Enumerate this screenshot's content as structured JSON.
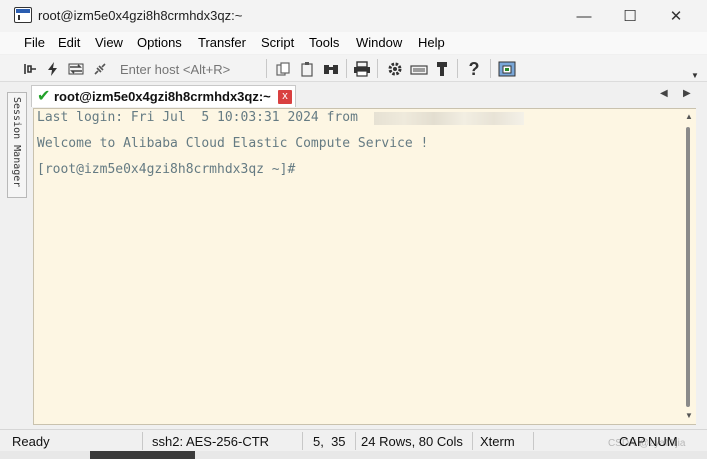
{
  "window": {
    "title": "root@izm5e0x4gzi8h8crmhdx3qz:~",
    "minimize_glyph": "—",
    "maximize_glyph": "☐",
    "close_glyph": "✕"
  },
  "menu": {
    "items": [
      "File",
      "Edit",
      "View",
      "Options",
      "Transfer",
      "Script",
      "Tools",
      "Window",
      "Help"
    ]
  },
  "toolbar": {
    "enter_host_placeholder": "Enter host <Alt+R>",
    "icons": [
      "connect-icon",
      "quick-connect-icon",
      "reconnect-icon",
      "disconnect-icon",
      "copy-icon",
      "paste-icon",
      "find-icon",
      "print-icon",
      "settings-icon",
      "keymap-icon",
      "sftp-icon",
      "help-icon",
      "screenshot-icon"
    ]
  },
  "sidebar": {
    "session_manager_label": "Session Manager"
  },
  "tab": {
    "label": "root@izm5e0x4gzi8h8crmhdx3qz:~",
    "close_glyph": "x",
    "check_glyph": "✔"
  },
  "terminal": {
    "lines": [
      "Last login: Fri Jul  5 10:03:31 2024 from ",
      "Welcome to Alibaba Cloud Elastic Compute Service !",
      "[root@izm5e0x4gzi8h8crmhdx3qz ~]#"
    ]
  },
  "statusbar": {
    "ready": "Ready",
    "cipher": "ssh2: AES-256-CTR",
    "cursor": "5,  35",
    "dimensions": "24 Rows, 80 Cols",
    "terminal_type": "Xterm",
    "caps": "CAP",
    "num": "NUM",
    "watermark": "CSDN @zyaMijia"
  },
  "colors": {
    "terminal_bg": "#fdf6e3",
    "terminal_fg": "#657b83",
    "tab_check": "#22a12a",
    "tab_close": "#d94040"
  }
}
